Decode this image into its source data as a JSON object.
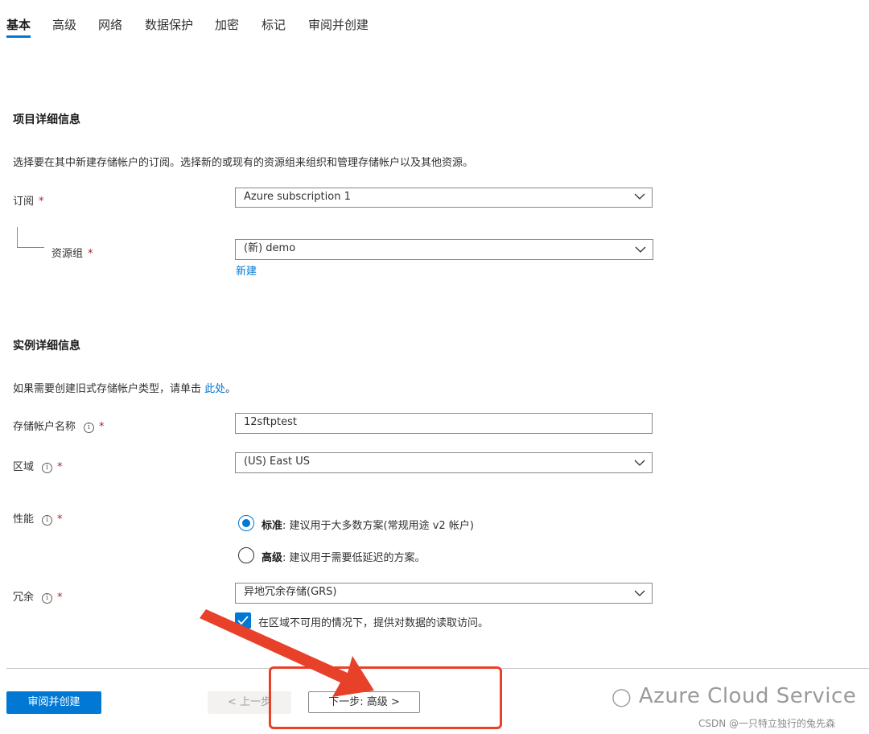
{
  "tabs": [
    "基本",
    "高级",
    "网络",
    "数据保护",
    "加密",
    "标记",
    "审阅并创建"
  ],
  "project_section": {
    "title": "项目详细信息",
    "description": "选择要在其中新建存储帐户的订阅。选择新的或现有的资源组来组织和管理存储帐户以及其他资源。",
    "subscription_label": "订阅",
    "subscription_value": "Azure subscription 1",
    "resource_group_label": "资源组",
    "resource_group_value": "(新) demo",
    "create_new_link": "新建"
  },
  "instance_section": {
    "title": "实例详细信息",
    "legacy_text": "如果需要创建旧式存储帐户类型，请单击",
    "legacy_link": "此处",
    "legacy_suffix": "。",
    "account_name_label": "存储帐户名称",
    "account_name_value": "12sftptest",
    "region_label": "区域",
    "region_value": "(US) East US",
    "performance_label": "性能",
    "perf_standard_title": "标准",
    "perf_standard_desc": ": 建议用于大多数方案(常规用途 v2 帐户)",
    "perf_premium_title": "高级",
    "perf_premium_desc": ": 建议用于需要低延迟的方案。",
    "redundancy_label": "冗余",
    "redundancy_value": "异地冗余存储(GRS)",
    "read_access_label": "在区域不可用的情况下，提供对数据的读取访问。",
    "required_mark": "*",
    "info_glyph": "i"
  },
  "footer": {
    "review_create_button": "审阅并创建",
    "previous_button": "< 上一步",
    "next_button": "下一步: 高级 >"
  },
  "watermark": {
    "brand": "Azure Cloud Service",
    "credit": "CSDN @一只特立独行的兔先森"
  },
  "colors": {
    "accent": "#0078d4",
    "required": "#a4262c",
    "annotation": "#e8412a"
  }
}
